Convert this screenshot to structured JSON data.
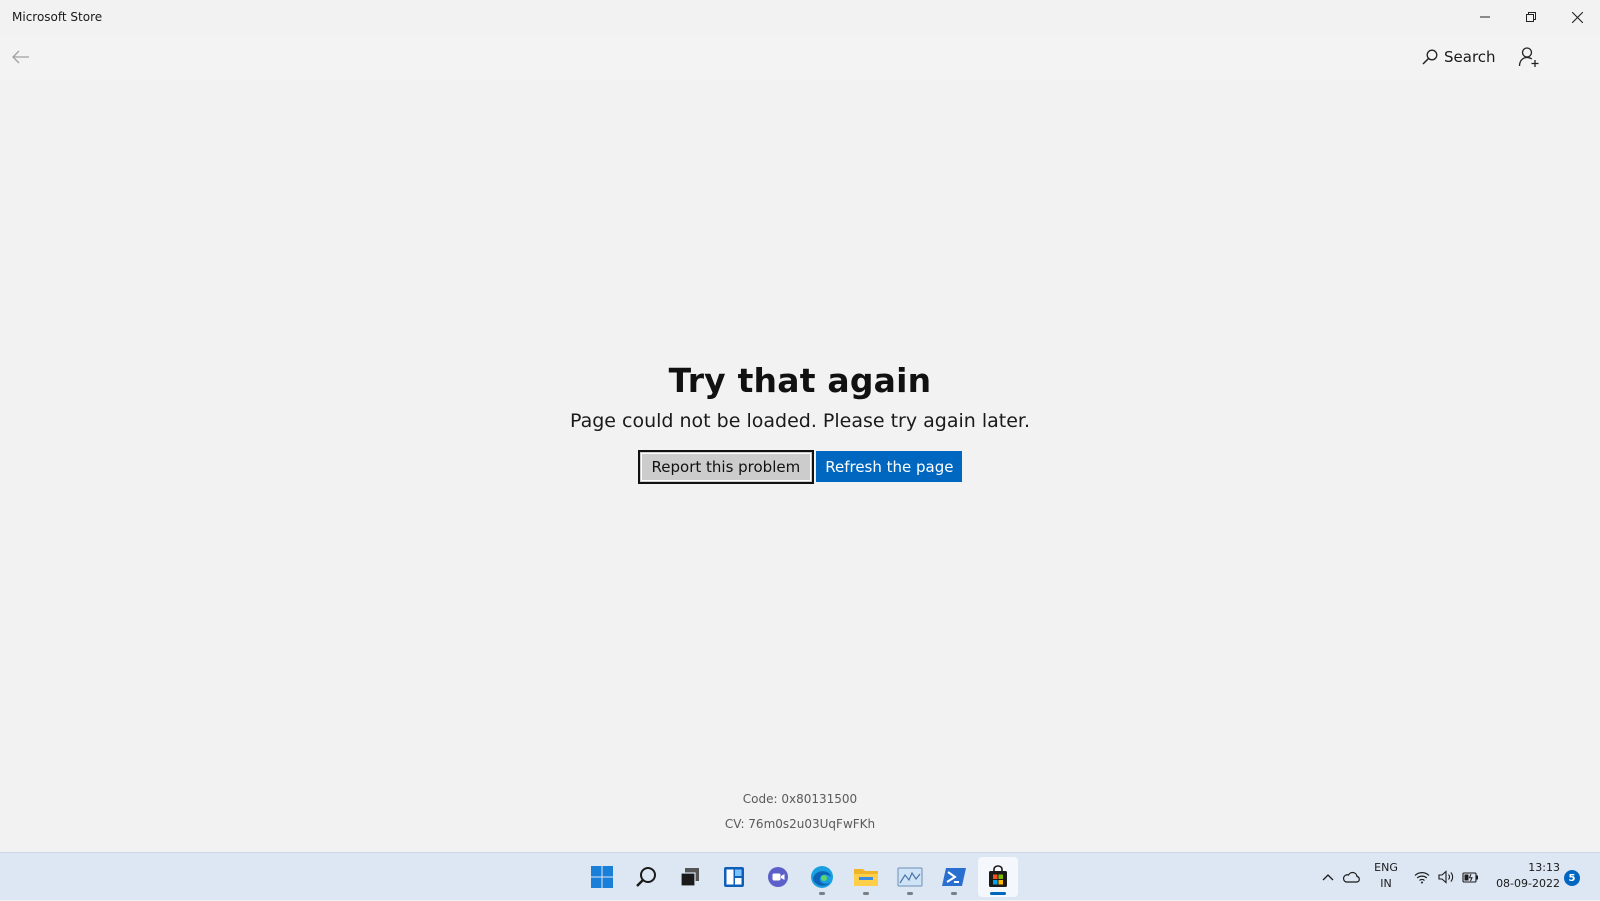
{
  "window": {
    "title": "Microsoft Store"
  },
  "header": {
    "search_label": "Search"
  },
  "error": {
    "title": "Try that again",
    "message": "Page could not be loaded. Please try again later.",
    "report_label": "Report this problem",
    "refresh_label": "Refresh the page",
    "code": "Code: 0x80131500",
    "cv": "CV: 76m0s2u03UqFwFKh"
  },
  "taskbar": {
    "pinned": [
      "windows-start-icon",
      "search-icon",
      "task-view-icon",
      "widgets-icon",
      "teams-chat-icon",
      "edge-icon",
      "file-explorer-icon",
      "photos-icon",
      "powershell-icon",
      "microsoft-store-icon"
    ],
    "active_app": "microsoft-store-icon",
    "language_line1": "ENG",
    "language_line2": "IN",
    "time": "13:13",
    "date": "08-09-2022",
    "notification_count": "5"
  },
  "colors": {
    "accent": "#0067c0",
    "window_bg": "#f2f2f2",
    "taskbar_bg": "#dde6f3"
  }
}
